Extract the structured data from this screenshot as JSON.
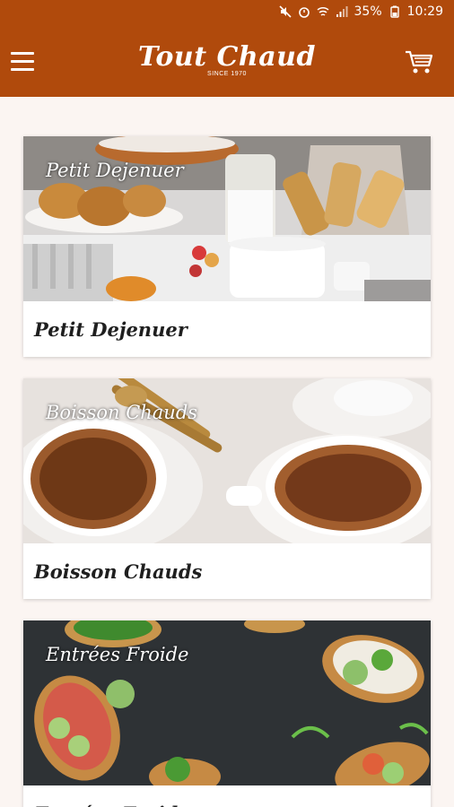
{
  "status_bar": {
    "battery": "35%",
    "time": "10:29"
  },
  "app_bar": {
    "logo_title": "Tout Chaud",
    "logo_subtitle": "SINCE 1970"
  },
  "categories": [
    {
      "image_title": "Petit Dejenuer",
      "label": "Petit Dejenuer"
    },
    {
      "image_title": "Boisson Chauds",
      "label": "Boisson Chauds"
    },
    {
      "image_title": "Entrées Froide",
      "label": "Entrées Froide"
    }
  ],
  "colors": {
    "brand": "#b04a0c",
    "background": "#fbf5f2"
  }
}
